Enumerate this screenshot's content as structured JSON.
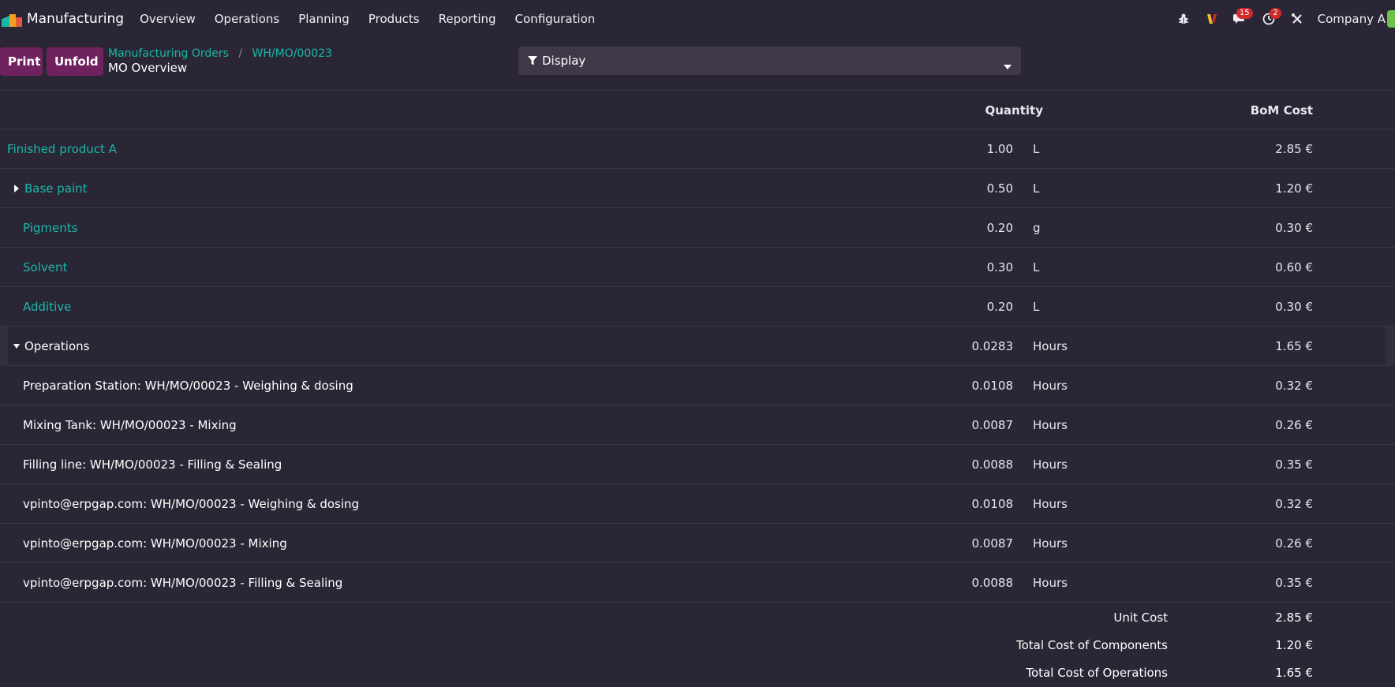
{
  "app": {
    "name": "Manufacturing",
    "menu": [
      "Overview",
      "Operations",
      "Planning",
      "Products",
      "Reporting",
      "Configuration"
    ]
  },
  "systray": {
    "messages_count": "15",
    "activities_count": "2",
    "company": "Company A"
  },
  "toolbar": {
    "print_label": "Print",
    "unfold_label": "Unfold",
    "display_label": "Display"
  },
  "breadcrumb": {
    "parent": "Manufacturing Orders",
    "current": "WH/MO/00023",
    "title": "MO Overview"
  },
  "table": {
    "headers": {
      "quantity": "Quantity",
      "bom_cost": "BoM Cost"
    },
    "rows": [
      {
        "name": "Finished product A",
        "qty": "1.00",
        "uom": "L",
        "cost": "2.85 €"
      },
      {
        "name": "Base paint",
        "qty": "0.50",
        "uom": "L",
        "cost": "1.20 €"
      },
      {
        "name": "Pigments",
        "qty": "0.20",
        "uom": "g",
        "cost": "0.30 €"
      },
      {
        "name": "Solvent",
        "qty": "0.30",
        "uom": "L",
        "cost": "0.60 €"
      },
      {
        "name": "Additive",
        "qty": "0.20",
        "uom": "L",
        "cost": "0.30 €"
      },
      {
        "name": "Operations",
        "qty": "0.0283",
        "uom": "Hours",
        "cost": "1.65 €"
      },
      {
        "name": "Preparation Station: WH/MO/00023 - Weighing & dosing",
        "qty": "0.0108",
        "uom": "Hours",
        "cost": "0.32 €"
      },
      {
        "name": "Mixing Tank: WH/MO/00023 - Mixing",
        "qty": "0.0087",
        "uom": "Hours",
        "cost": "0.26 €"
      },
      {
        "name": "Filling line: WH/MO/00023 - Filling & Sealing",
        "qty": "0.0088",
        "uom": "Hours",
        "cost": "0.35 €"
      },
      {
        "name": "vpinto@erpgap.com: WH/MO/00023 - Weighing & dosing",
        "qty": "0.0108",
        "uom": "Hours",
        "cost": "0.32 €"
      },
      {
        "name": "vpinto@erpgap.com: WH/MO/00023 - Mixing",
        "qty": "0.0087",
        "uom": "Hours",
        "cost": "0.26 €"
      },
      {
        "name": "vpinto@erpgap.com: WH/MO/00023 - Filling & Sealing",
        "qty": "0.0088",
        "uom": "Hours",
        "cost": "0.35 €"
      }
    ]
  },
  "totals": [
    {
      "label": "Unit Cost",
      "value": "2.85 €"
    },
    {
      "label": "Total Cost of Components",
      "value": "1.20 €"
    },
    {
      "label": "Total Cost of Operations",
      "value": "1.65 €"
    }
  ],
  "colors": {
    "background": "#2a2635",
    "link": "#1ab8a8",
    "primary_button": "#70225f",
    "badge": "#d12a2a"
  }
}
